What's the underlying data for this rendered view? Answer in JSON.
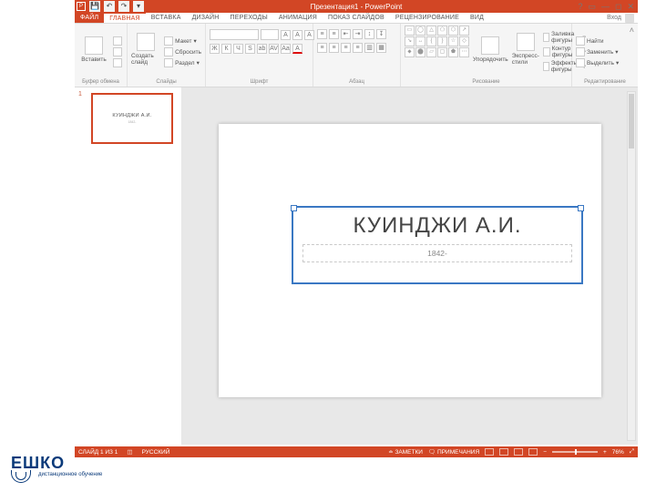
{
  "app": {
    "title_doc": "Презентация1",
    "title_app": "PowerPoint",
    "signin": "Вход"
  },
  "tabs": {
    "file": "ФАЙЛ",
    "items": [
      "ГЛАВНАЯ",
      "ВСТАВКА",
      "ДИЗАЙН",
      "ПЕРЕХОДЫ",
      "АНИМАЦИЯ",
      "ПОКАЗ СЛАЙДОВ",
      "РЕЦЕНЗИРОВАНИЕ",
      "ВИД"
    ],
    "active_index": 0
  },
  "ribbon": {
    "clipboard": {
      "paste": "Вставить",
      "label": "Буфер обмена"
    },
    "slides": {
      "new": "Создать слайд",
      "layout": "Макет",
      "reset": "Сбросить",
      "section": "Раздел",
      "label": "Слайды"
    },
    "font": {
      "label": "Шрифт"
    },
    "paragraph": {
      "label": "Абзац"
    },
    "drawing": {
      "arrange": "Упорядочить",
      "express": "Экспресс-стили",
      "shape_fill": "Заливка фигуры",
      "shape_outline": "Контур фигуры",
      "shape_effects": "Эффекты фигуры",
      "label": "Рисование"
    },
    "editing": {
      "find": "Найти",
      "replace": "Заменить",
      "select": "Выделить",
      "label": "Редактирование"
    }
  },
  "thumbs": {
    "num": "1",
    "title": "КУИНДЖИ А.И.",
    "sub": "1842-"
  },
  "slide": {
    "title": "КУИНДЖИ А.И.",
    "subtitle": "1842-"
  },
  "status": {
    "slide": "СЛАЙД 1 ИЗ 1",
    "lang": "РУССКИЙ",
    "notes": "ЗАМЕТКИ",
    "comments": "ПРИМЕЧАНИЯ",
    "zoom": "76%"
  },
  "logo": {
    "brand": "ЕШКО",
    "tag": "дистанционное обучение"
  }
}
